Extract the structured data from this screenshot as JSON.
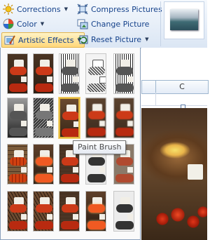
{
  "ribbon": {
    "corrections": {
      "label": "Corrections",
      "icon": "sun-icon"
    },
    "color": {
      "label": "Color",
      "icon": "color-palette-icon"
    },
    "artistic_effects": {
      "label": "Artistic Effects",
      "icon": "artistic-brush-icon",
      "active": true
    },
    "compress_pictures": {
      "label": "Compress Pictures",
      "icon": "compress-icon"
    },
    "change_picture": {
      "label": "Change Picture",
      "icon": "change-picture-icon"
    },
    "reset_picture": {
      "label": "Reset Picture",
      "icon": "reset-picture-icon"
    },
    "dropdown_arrow": "▼"
  },
  "sheet": {
    "column_header": "C"
  },
  "gallery": {
    "selected_effect": "Paint Brush",
    "rows": 4,
    "columns": 5
  },
  "tooltip": {
    "text": "Paint Brush"
  },
  "colors": {
    "selection_border": "#e1b63c",
    "ribbon_text": "#15428b",
    "active_button_fill": "#ffd77a"
  }
}
